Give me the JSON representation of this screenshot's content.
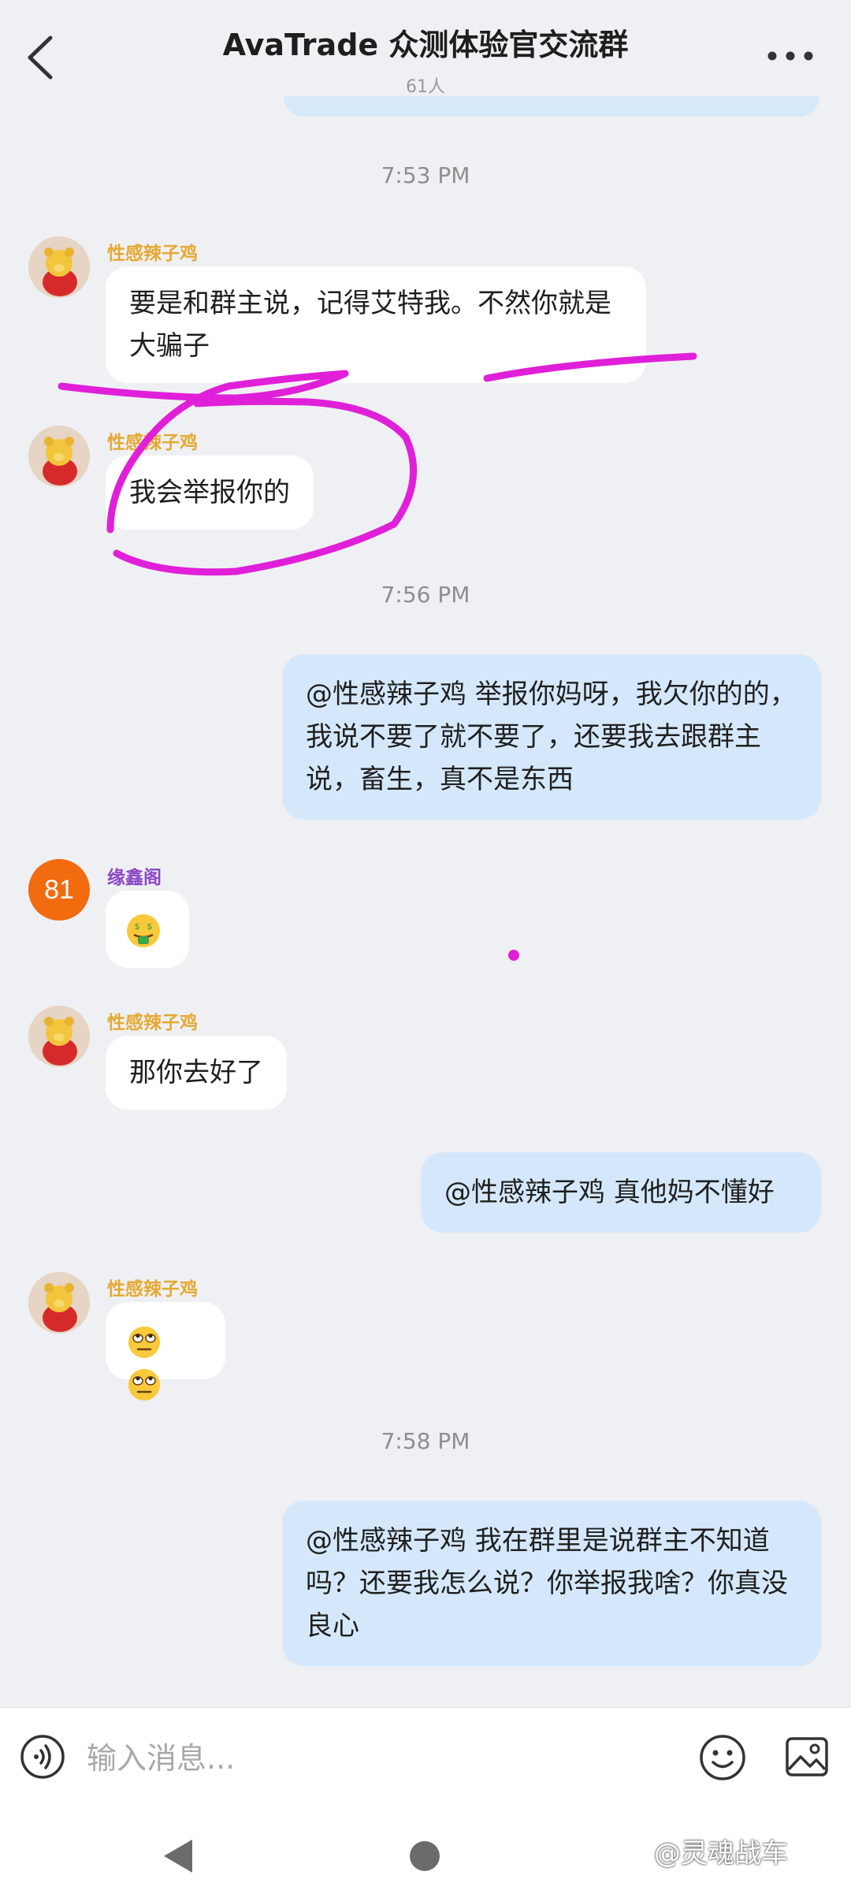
{
  "header": {
    "title": "AvaTrade 众测体验官交流群",
    "member_count": "61人",
    "back_icon": "chevron-left-icon",
    "more_icon": "more-dots-icon"
  },
  "messages": {
    "t1": "7:53 PM",
    "m1_name": "性感辣子鸡",
    "m1_text": "要是和群主说，记得艾特我。不然你就是大骗子",
    "m2_name": "性感辣子鸡",
    "m2_text": "我会举报你的",
    "t2": "7:56 PM",
    "m3_text": "@性感辣子鸡 举报你妈呀，我欠你的的，我说不要了就不要了，还要我去跟群主说，畜生，真不是东西",
    "m4_avatar": "81",
    "m4_name": "缘鑫阁",
    "m4_emoji": "money-mouth-face",
    "m5_name": "性感辣子鸡",
    "m5_text": "那你去好了",
    "m6_text": "@性感辣子鸡 真他妈不懂好",
    "m7_name": "性感辣子鸡",
    "m7_emoji": "eye-roll-face x2",
    "t3": "7:58 PM",
    "m8_text": "@性感辣子鸡 我在群里是说群主不知道吗？还要我怎么说？你举报我啥？你真没良心"
  },
  "input_bar": {
    "placeholder": "输入消息..."
  },
  "watermark": "@灵魂战车",
  "colors": {
    "background": "#eff0f3",
    "outgoing_bubble": "#d5e8fb",
    "incoming_bubble": "#ffffff",
    "sender_name": "#e4a933",
    "sender_name_alt": "#8a46c4",
    "avatar_orange": "#f26b0f",
    "annotation": "#e020d8"
  }
}
